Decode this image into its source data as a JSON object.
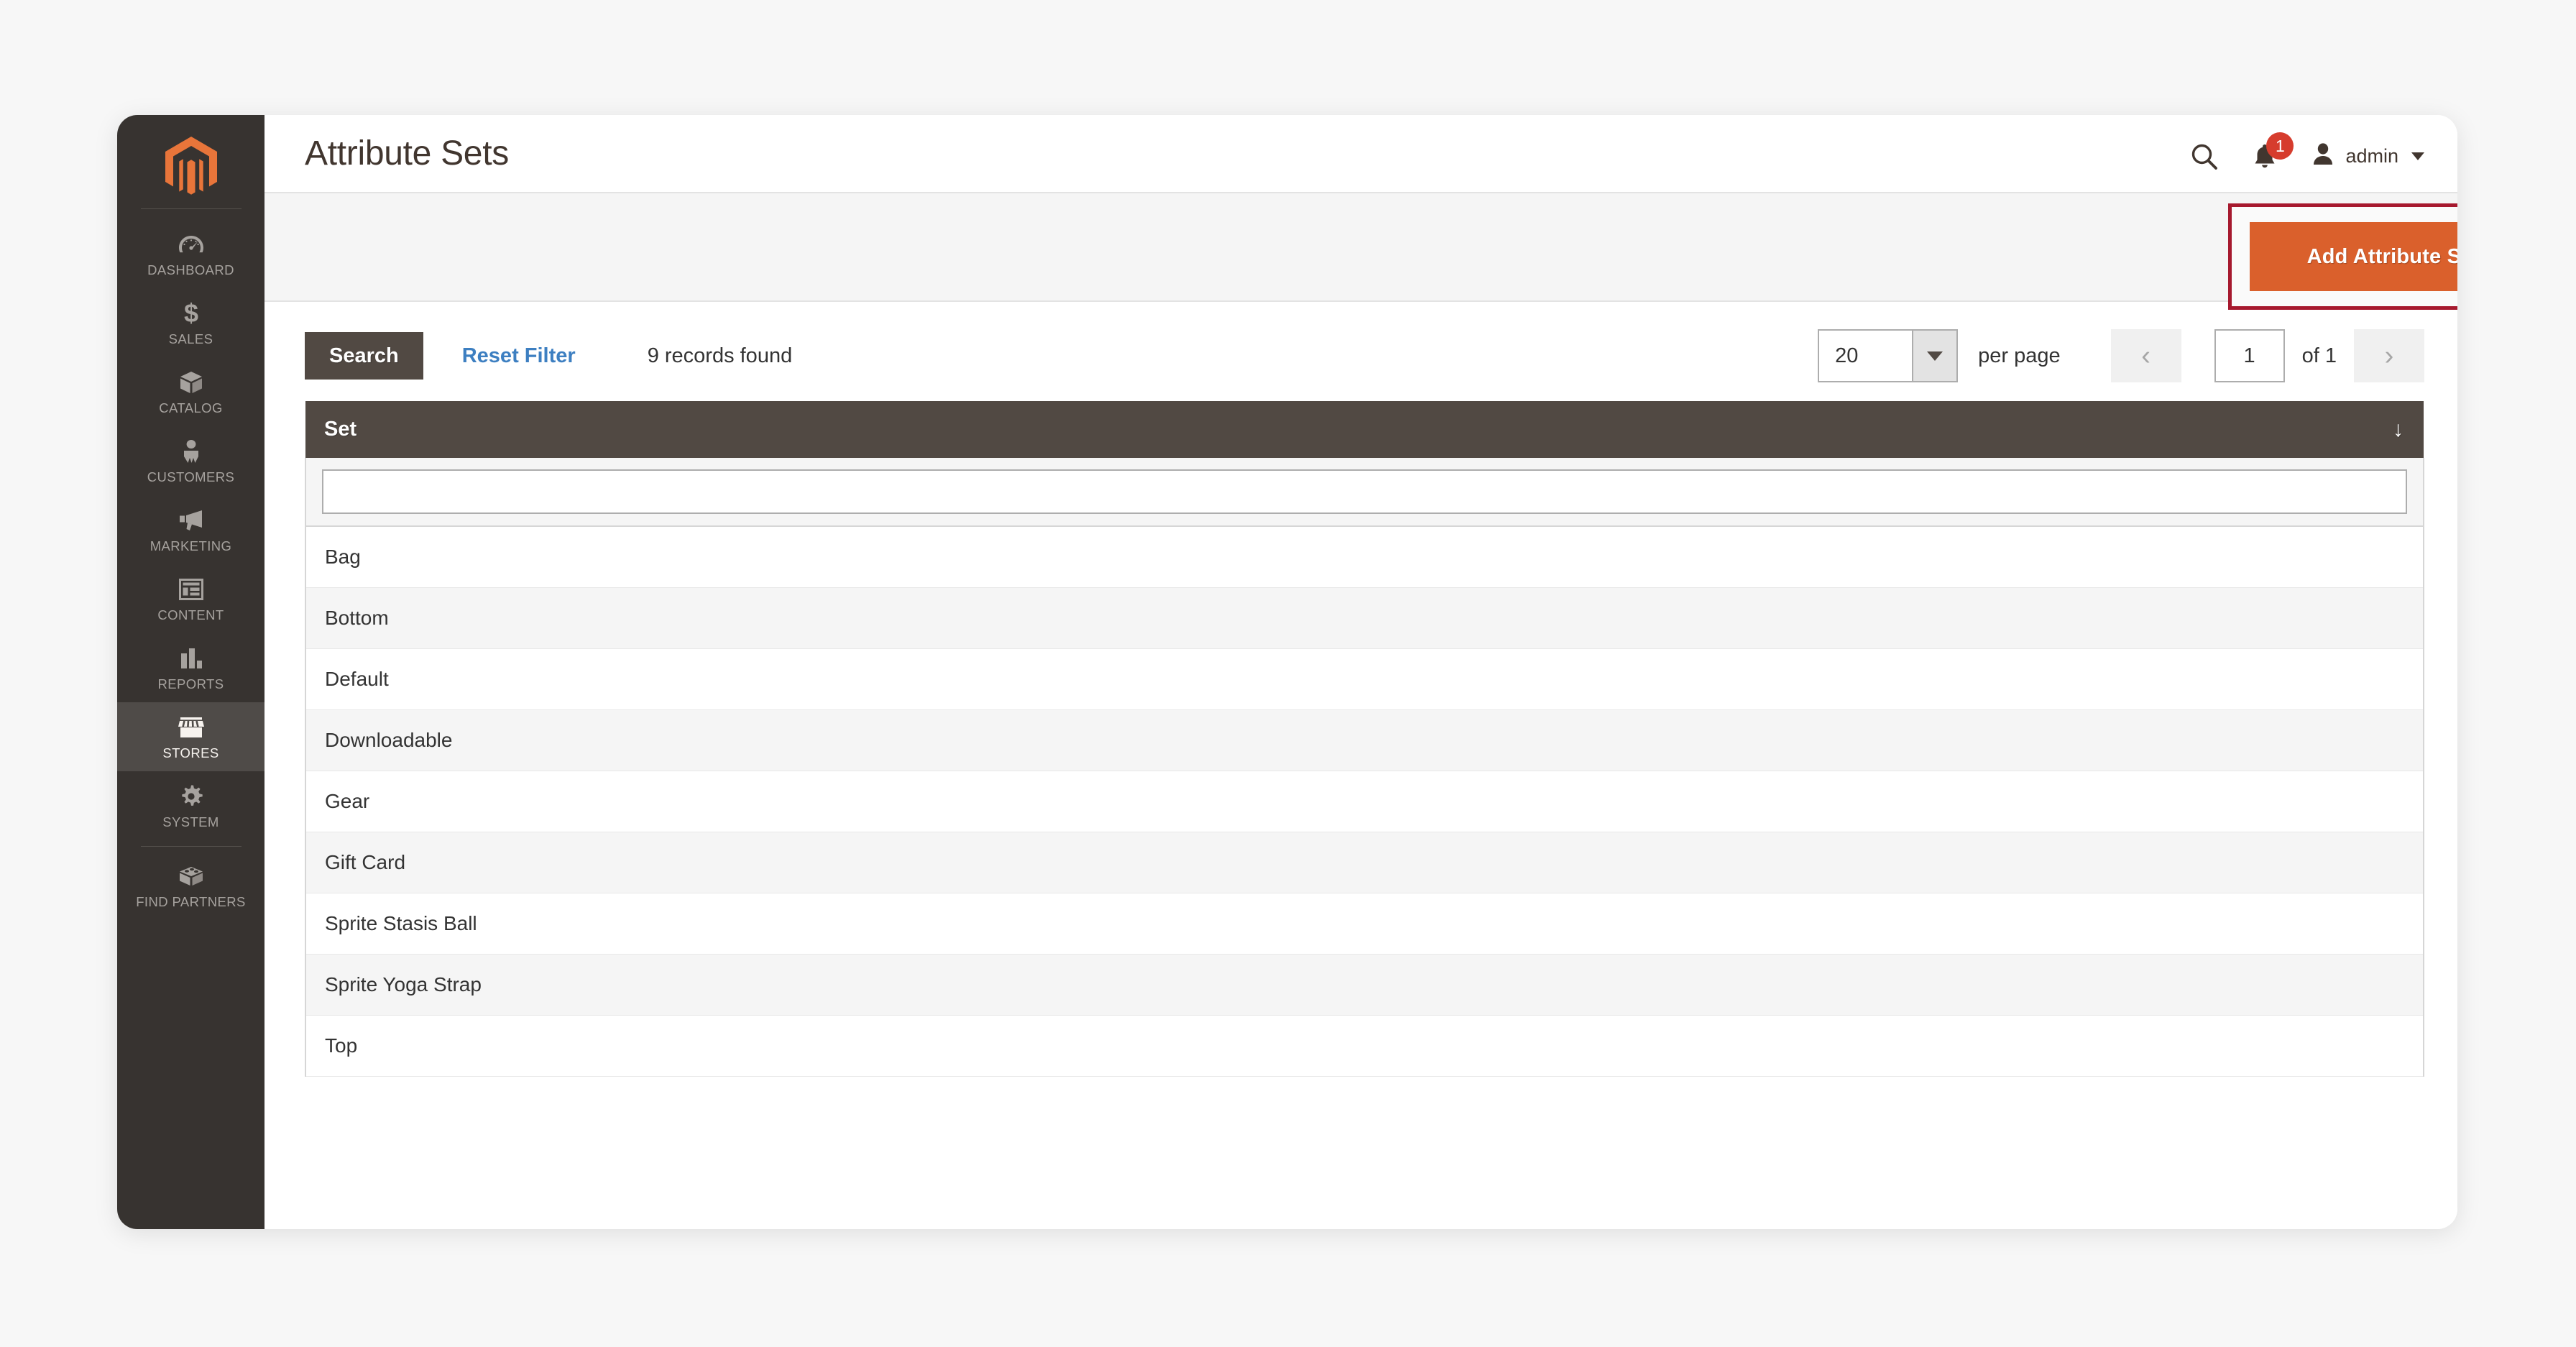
{
  "sidebar": {
    "logo": "magento-logo",
    "items": [
      {
        "label": "DASHBOARD",
        "icon": "dashboard-gauge-icon",
        "active": false
      },
      {
        "label": "SALES",
        "icon": "dollar-sign-icon",
        "active": false
      },
      {
        "label": "CATALOG",
        "icon": "box-icon",
        "active": false
      },
      {
        "label": "CUSTOMERS",
        "icon": "person-icon",
        "active": false
      },
      {
        "label": "MARKETING",
        "icon": "megaphone-icon",
        "active": false
      },
      {
        "label": "CONTENT",
        "icon": "layout-window-icon",
        "active": false
      },
      {
        "label": "REPORTS",
        "icon": "bar-chart-icon",
        "active": false
      },
      {
        "label": "STORES",
        "icon": "storefront-icon",
        "active": true
      },
      {
        "label": "SYSTEM",
        "icon": "gear-icon",
        "active": false
      },
      {
        "label": "FIND PARTNERS",
        "icon": "extension-block-icon",
        "active": false
      }
    ]
  },
  "header": {
    "title": "Attribute Sets",
    "search_icon": "search-icon",
    "notifications_icon": "bell-icon",
    "notifications_count": "1",
    "user_icon": "user-avatar-icon",
    "user_name": "admin",
    "user_caret": "chevron-down-icon"
  },
  "page_actions": {
    "add_button_label": "Add Attribute Set",
    "highlight_color": "#a6192e",
    "button_color": "#da602c"
  },
  "toolbar": {
    "search_label": "Search",
    "reset_filter_label": "Reset Filter",
    "records_found": "9 records found",
    "per_page_value": "20",
    "per_page_label": "per page",
    "prev_icon": "chevron-left-icon",
    "next_icon": "chevron-right-icon",
    "page_number": "1",
    "of_label": "of 1"
  },
  "grid": {
    "columns": [
      {
        "label": "Set",
        "sort_icon": "arrow-down-icon",
        "sort_dir": "desc"
      }
    ],
    "filter_value": "",
    "filter_placeholder": "",
    "rows": [
      {
        "set": "Bag"
      },
      {
        "set": "Bottom"
      },
      {
        "set": "Default"
      },
      {
        "set": "Downloadable"
      },
      {
        "set": "Gear"
      },
      {
        "set": "Gift Card"
      },
      {
        "set": "Sprite Stasis Ball"
      },
      {
        "set": "Sprite Yoga Strap"
      },
      {
        "set": "Top"
      }
    ]
  }
}
